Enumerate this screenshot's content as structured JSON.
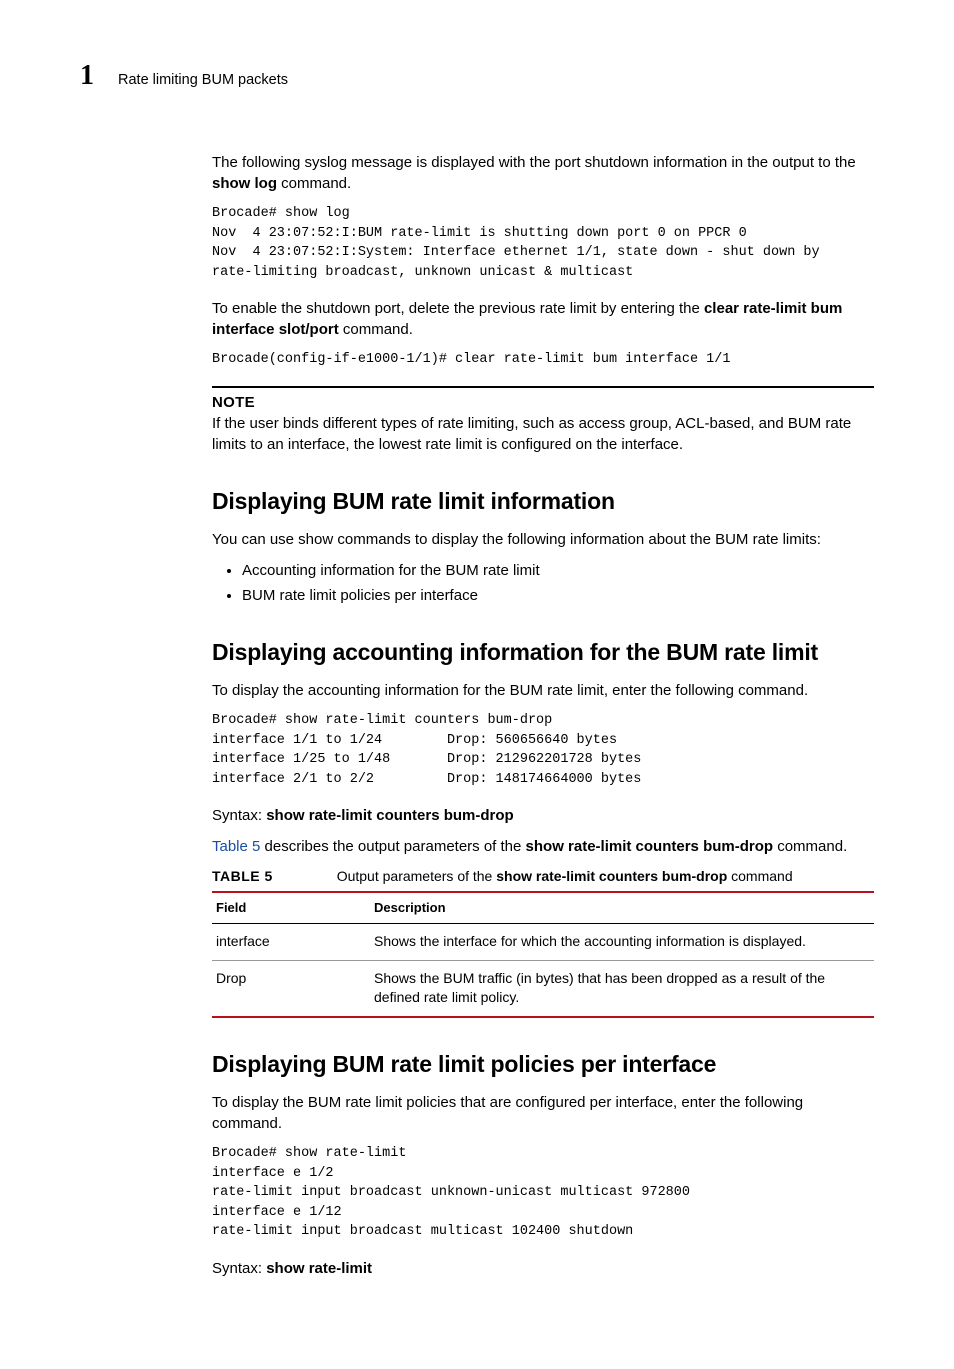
{
  "header": {
    "chapter_number": "1",
    "title": "Rate limiting BUM packets"
  },
  "intro": {
    "para1_a": "The following syslog message is displayed with the port shutdown information in the output to the ",
    "para1_cmd": "show log",
    "para1_b": " command.",
    "code1": "Brocade# show log\nNov  4 23:07:52:I:BUM rate-limit is shutting down port 0 on PPCR 0\nNov  4 23:07:52:I:System: Interface ethernet 1/1, state down - shut down by\nrate-limiting broadcast, unknown unicast & multicast",
    "para2_a": "To enable the shutdown port, delete the previous rate limit by entering the ",
    "para2_cmd": "clear rate-limit bum interface slot/port",
    "para2_b": " command.",
    "code2": "Brocade(config-if-e1000-1/1)# clear rate-limit bum interface 1/1"
  },
  "note": {
    "label": "NOTE",
    "text": "If the user binds different types of rate limiting, such as access group, ACL-based, and BUM rate limits to an interface, the lowest rate limit is configured on the interface."
  },
  "sec1": {
    "heading": "Displaying BUM rate limit information",
    "intro": "You can use show commands to display the following information about the BUM rate limits:",
    "bullets": [
      "Accounting information for the BUM rate limit",
      "BUM rate limit policies per interface"
    ]
  },
  "sec2": {
    "heading": "Displaying accounting information for the BUM rate limit",
    "intro": "To display the accounting information for the BUM rate limit, enter the following command.",
    "code": "Brocade# show rate-limit counters bum-drop\ninterface 1/1 to 1/24        Drop: 560656640 bytes\ninterface 1/25 to 1/48       Drop: 212962201728 bytes\ninterface 2/1 to 2/2         Drop: 148174664000 bytes",
    "syntax_label": "Syntax:",
    "syntax_cmd": "show rate-limit counters bum-drop",
    "tableref_link": "Table 5",
    "tableref_a": " describes the output parameters of the ",
    "tableref_cmd": "show rate-limit counters bum-drop",
    "tableref_b": " command."
  },
  "table5": {
    "caption_label": "TABLE 5",
    "caption_a": "Output parameters of the  ",
    "caption_cmd": "show rate-limit counters bum-drop",
    "caption_b": " command",
    "col_field": "Field",
    "col_desc": "Description",
    "rows": [
      {
        "field": "interface",
        "desc": "Shows the interface for which the accounting information is displayed."
      },
      {
        "field": "Drop",
        "desc": "Shows the BUM traffic (in bytes) that has been dropped as a result of the defined rate limit policy."
      }
    ]
  },
  "sec3": {
    "heading": "Displaying BUM rate limit policies per interface",
    "intro": "To display the BUM rate limit policies that are configured per interface, enter the following command.",
    "code": "Brocade# show rate-limit\ninterface e 1/2\nrate-limit input broadcast unknown-unicast multicast 972800\ninterface e 1/12\nrate-limit input broadcast multicast 102400 shutdown",
    "syntax_label": "Syntax:",
    "syntax_cmd": "show rate-limit"
  }
}
